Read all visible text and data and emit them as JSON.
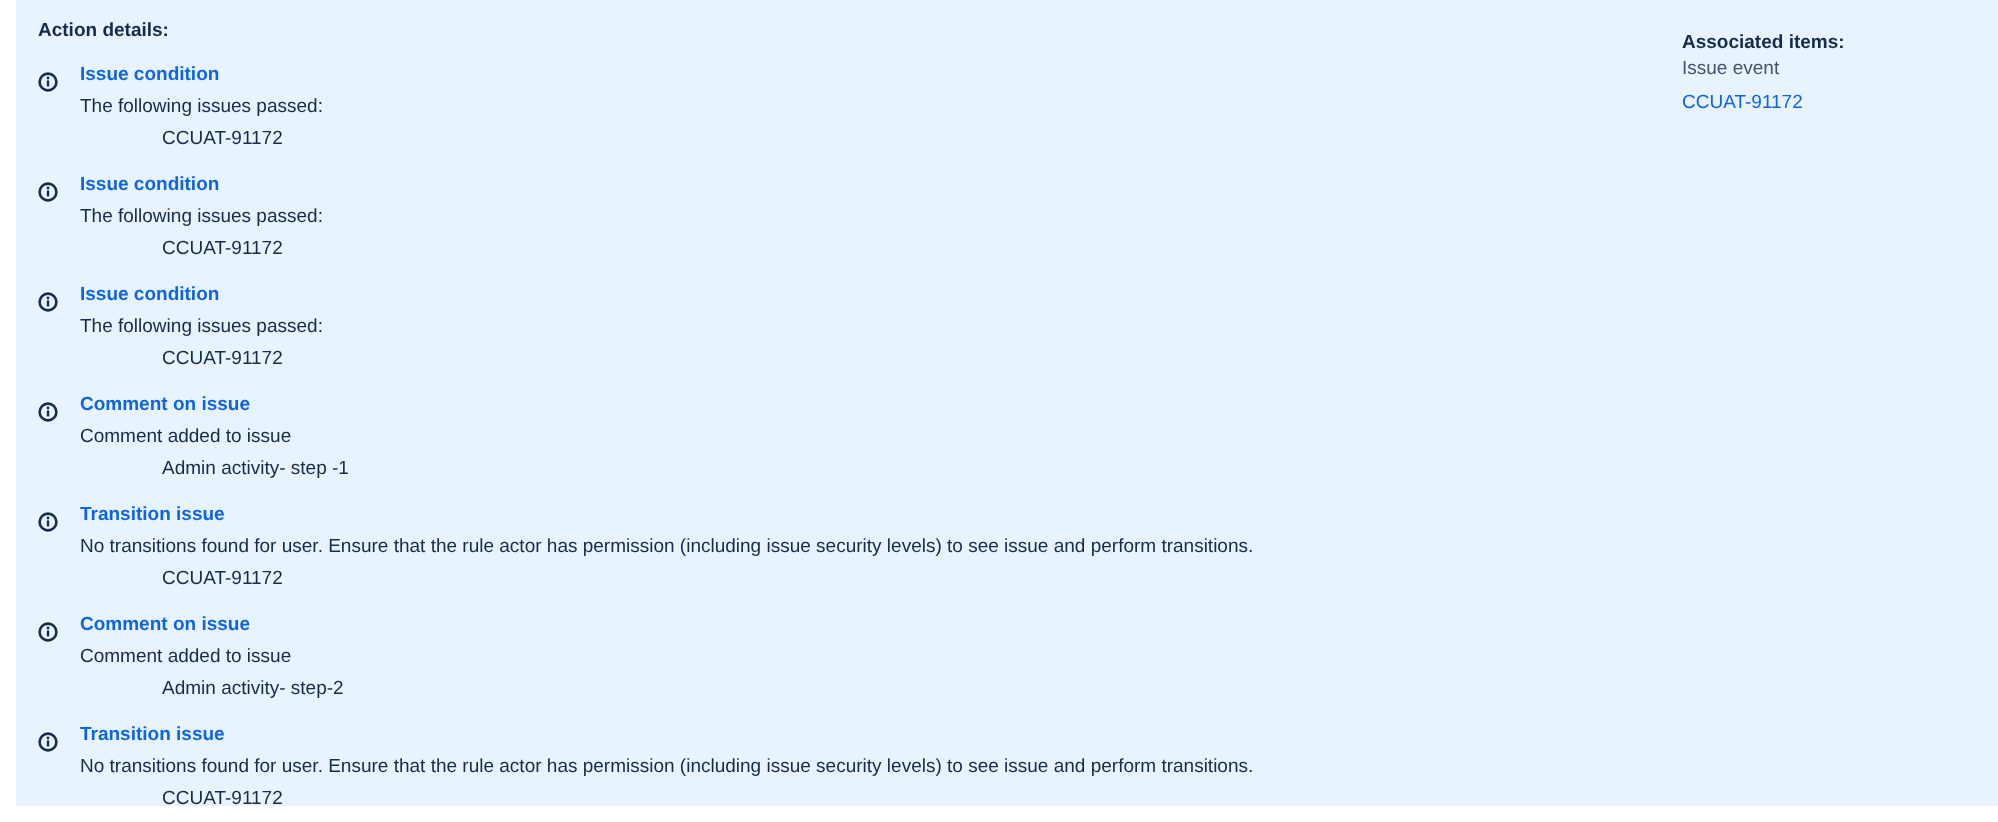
{
  "action_details": {
    "heading": "Action details:",
    "actions": [
      {
        "title": "Issue condition",
        "description": "The following issues passed:",
        "detail": "CCUAT-91172"
      },
      {
        "title": "Issue condition",
        "description": "The following issues passed:",
        "detail": "CCUAT-91172"
      },
      {
        "title": "Issue condition",
        "description": "The following issues passed:",
        "detail": "CCUAT-91172"
      },
      {
        "title": "Comment on issue",
        "description": "Comment added to issue",
        "detail": "Admin activity- step -1"
      },
      {
        "title": "Transition issue",
        "description": "No transitions found for user. Ensure that the rule actor has permission (including issue security levels) to see issue and perform transitions.",
        "detail": "CCUAT-91172"
      },
      {
        "title": "Comment on issue",
        "description": "Comment added to issue",
        "detail": "Admin activity- step-2"
      },
      {
        "title": "Transition issue",
        "description": "No transitions found for user. Ensure that the rule actor has permission (including issue security levels) to see issue and perform transitions.",
        "detail": "CCUAT-91172"
      }
    ]
  },
  "associated_items": {
    "heading": "Associated items:",
    "label": "Issue event",
    "link": "CCUAT-91172"
  }
}
